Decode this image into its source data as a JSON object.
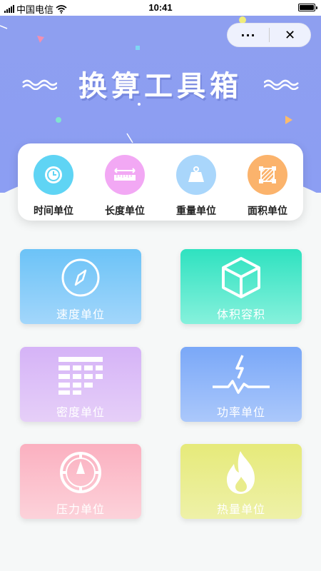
{
  "status_bar": {
    "carrier": "中国电信",
    "time": "10:41"
  },
  "capsule": {
    "more": "···",
    "close": "✕"
  },
  "header": {
    "title": "换算工具箱",
    "background": "#8e9ff0"
  },
  "quick_menu": [
    {
      "label": "时间单位",
      "icon": "clock-icon",
      "color": "#5fd4f4"
    },
    {
      "label": "长度单位",
      "icon": "ruler-icon",
      "color": "#f2a8f4"
    },
    {
      "label": "重量单位",
      "icon": "weight-icon",
      "color": "#a9d6fb"
    },
    {
      "label": "面积单位",
      "icon": "area-icon",
      "color": "#fbb36c"
    }
  ],
  "tools": [
    {
      "label": "速度单位",
      "icon": "compass-icon"
    },
    {
      "label": "体积容积",
      "icon": "cube-icon"
    },
    {
      "label": "密度单位",
      "icon": "grid-icon"
    },
    {
      "label": "功率单位",
      "icon": "lightning-icon"
    },
    {
      "label": "压力单位",
      "icon": "gauge-icon"
    },
    {
      "label": "热量单位",
      "icon": "flame-icon"
    }
  ]
}
